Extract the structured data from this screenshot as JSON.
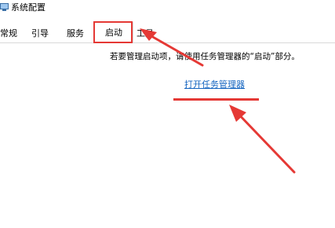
{
  "window": {
    "title": "系统配置"
  },
  "tabs": [
    {
      "label": "常规"
    },
    {
      "label": "引导"
    },
    {
      "label": "服务"
    },
    {
      "label": "启动"
    },
    {
      "label": "工具"
    }
  ],
  "active_tab": "启动",
  "startup": {
    "hint": "若要管理启动项，请使用任务管理器的“启动”部分。",
    "open_link": "打开任务管理器"
  },
  "annotations": {
    "color": "#e53935"
  },
  "colors": {
    "link": "#1565c0",
    "tab_border": "#d9d9d9"
  }
}
